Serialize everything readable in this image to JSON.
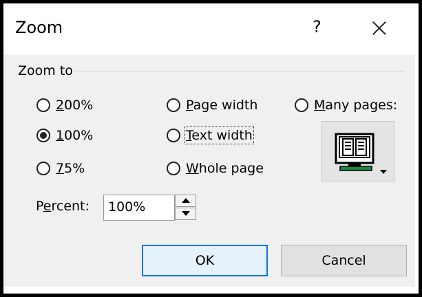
{
  "dialog": {
    "title": "Zoom",
    "help_label": "?"
  },
  "group": {
    "label": "Zoom to"
  },
  "options": {
    "p200": {
      "prefix": "",
      "accel": "2",
      "rest": "00%",
      "checked": false
    },
    "p100": {
      "prefix": "",
      "accel": "1",
      "rest": "00%",
      "checked": true
    },
    "p75": {
      "prefix": "",
      "accel": "7",
      "rest": "5%",
      "checked": false
    },
    "page_width": {
      "prefix": "",
      "accel": "P",
      "rest": "age width",
      "checked": false
    },
    "text_width": {
      "prefix": "",
      "accel": "T",
      "rest": "ext width",
      "checked": false
    },
    "whole_page": {
      "prefix": "",
      "accel": "W",
      "rest": "hole page",
      "checked": false
    },
    "many_pages": {
      "prefix": "",
      "accel": "M",
      "rest": "any pages:",
      "checked": false
    }
  },
  "percent": {
    "label_prefix": "P",
    "label_accel": "e",
    "label_rest": "rcent:",
    "value": "100%"
  },
  "buttons": {
    "ok": "OK",
    "cancel": "Cancel"
  },
  "icons": {
    "many_pages_button": "monitor-pages-icon",
    "close": "close-icon"
  }
}
